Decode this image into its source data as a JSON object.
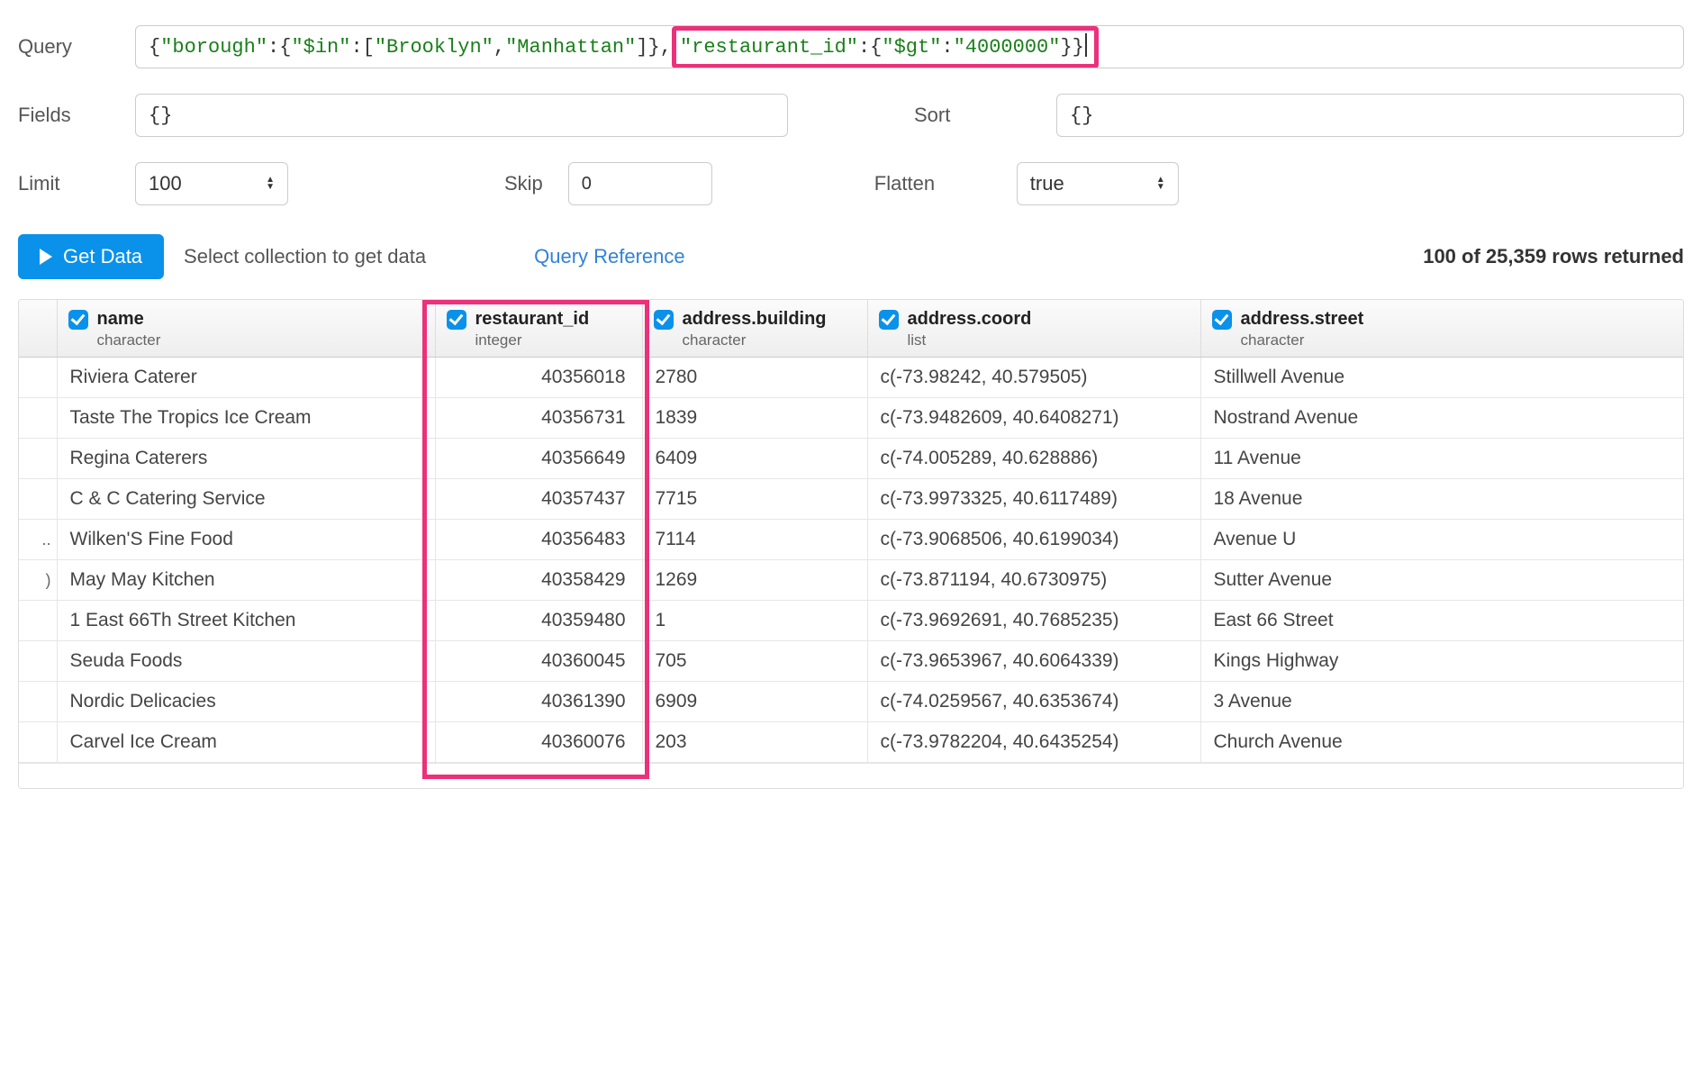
{
  "labels": {
    "query": "Query",
    "fields": "Fields",
    "sort": "Sort",
    "limit": "Limit",
    "skip": "Skip",
    "flatten": "Flatten"
  },
  "query_tokens": {
    "lead": "{\"borough\":{\"$in\":[\"Brooklyn\",\"Manhattan\"]},",
    "hi": " \"restaurant_id\":{\"$gt\":\"4000000\"}}"
  },
  "inputs": {
    "fields": "{}",
    "sort": "{}",
    "limit": "100",
    "skip": "0",
    "flatten": "true"
  },
  "actions": {
    "get_data": "Get Data",
    "hint": "Select collection to get data",
    "reference": "Query Reference"
  },
  "status": {
    "prefix": "100 of 25,359",
    "suffix": " rows returned"
  },
  "columns": [
    {
      "name": "name",
      "type": "character"
    },
    {
      "name": "restaurant_id",
      "type": "integer"
    },
    {
      "name": "address.building",
      "type": "character"
    },
    {
      "name": "address.coord",
      "type": "list"
    },
    {
      "name": "address.street",
      "type": "character"
    }
  ],
  "rows": [
    {
      "handle": "",
      "name": "Riviera Caterer",
      "id": "40356018",
      "bldg": "2780",
      "coord": "c(-73.98242, 40.579505)",
      "street": "Stillwell Avenue"
    },
    {
      "handle": "",
      "name": "Taste The Tropics Ice Cream",
      "id": "40356731",
      "bldg": "1839",
      "coord": "c(-73.9482609, 40.6408271)",
      "street": "Nostrand Avenue"
    },
    {
      "handle": "",
      "name": "Regina Caterers",
      "id": "40356649",
      "bldg": "6409",
      "coord": "c(-74.005289, 40.628886)",
      "street": "11 Avenue"
    },
    {
      "handle": "",
      "name": "C & C Catering Service",
      "id": "40357437",
      "bldg": "7715",
      "coord": "c(-73.9973325, 40.6117489)",
      "street": "18 Avenue"
    },
    {
      "handle": "..",
      "name": "Wilken'S Fine Food",
      "id": "40356483",
      "bldg": "7114",
      "coord": "c(-73.9068506, 40.6199034)",
      "street": "Avenue U"
    },
    {
      "handle": ")",
      "name": "May May Kitchen",
      "id": "40358429",
      "bldg": "1269",
      "coord": "c(-73.871194, 40.6730975)",
      "street": "Sutter Avenue"
    },
    {
      "handle": "",
      "name": "1 East 66Th Street Kitchen",
      "id": "40359480",
      "bldg": "1",
      "coord": "c(-73.9692691, 40.7685235)",
      "street": "East   66 Street"
    },
    {
      "handle": "",
      "name": "Seuda Foods",
      "id": "40360045",
      "bldg": "705",
      "coord": "c(-73.9653967, 40.6064339)",
      "street": "Kings Highway"
    },
    {
      "handle": "",
      "name": "Nordic Delicacies",
      "id": "40361390",
      "bldg": "6909",
      "coord": "c(-74.0259567, 40.6353674)",
      "street": "3 Avenue"
    },
    {
      "handle": "",
      "name": "Carvel Ice Cream",
      "id": "40360076",
      "bldg": "203",
      "coord": "c(-73.9782204, 40.6435254)",
      "street": "Church Avenue"
    }
  ]
}
